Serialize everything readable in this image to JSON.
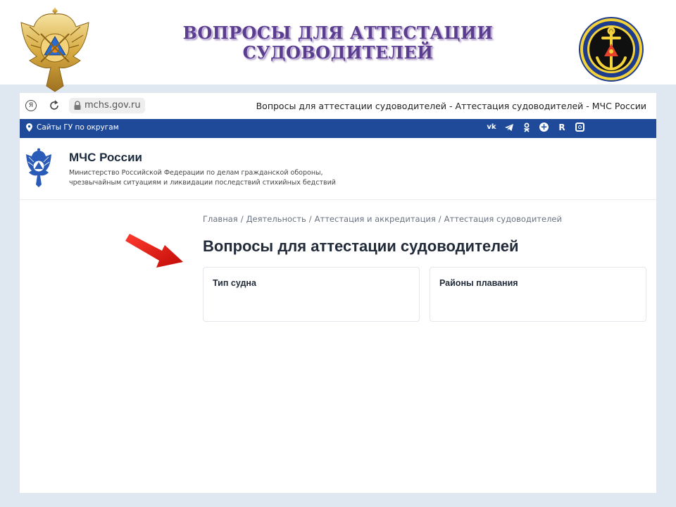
{
  "slide": {
    "title_line1": "ВОПРОСЫ ДЛЯ АТТЕСТАЦИИ",
    "title_line2": "СУДОВОДИТЕЛЕЙ"
  },
  "browser": {
    "yandex_button": "Я",
    "url": "mchs.gov.ru",
    "tab_title": "Вопросы для аттестации судоводителей - Аттестация судоводителей - МЧС России"
  },
  "topbar": {
    "regions_link": "Сайты ГУ по округам",
    "social": [
      {
        "name": "vk-icon",
        "glyph": "vk"
      },
      {
        "name": "telegram-icon",
        "glyph": "tg"
      },
      {
        "name": "odnoklassniki-icon",
        "glyph": "ok"
      },
      {
        "name": "plus-icon",
        "glyph": "+"
      },
      {
        "name": "rutube-icon",
        "glyph": "R"
      },
      {
        "name": "dzen-icon",
        "glyph": "dz"
      }
    ]
  },
  "site": {
    "name": "МЧС России",
    "description": "Министерство Российской Федерации по делам гражданской обороны, чрезвычайным ситуациям и ликвидации последствий стихийных бедствий"
  },
  "breadcrumb": [
    "Главная",
    "Деятельность",
    "Аттестация и аккредитация",
    "Аттестация судоводителей"
  ],
  "page": {
    "title": "Вопросы для аттестации судоводителей",
    "filters": [
      "Тип судна",
      "Районы плавания"
    ]
  },
  "colors": {
    "topbar": "#1f4a99",
    "slide_title": "#5b3d8f",
    "arrow": "#e3120b",
    "slide_bg": "#dfe7f1"
  }
}
